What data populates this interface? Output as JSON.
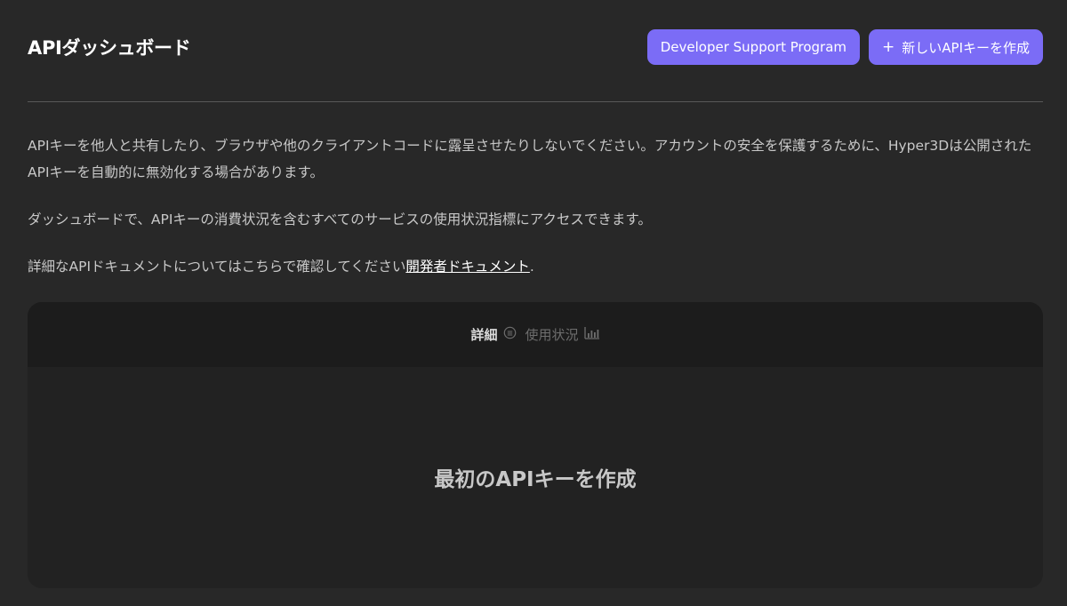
{
  "header": {
    "title": "APIダッシュボード",
    "developer_support_label": "Developer Support Program",
    "create_key_label": "新しいAPIキーを作成"
  },
  "intro": {
    "paragraph1": "APIキーを他人と共有したり、ブラウザや他のクライアントコードに露呈させたりしないでください。アカウントの安全を保護するために、Hyper3Dは公開されたAPIキーを自動的に無効化する場合があります。",
    "paragraph2": "ダッシュボードで、APIキーの消費状況を含むすべてのサービスの使用状況指標にアクセスできます。",
    "paragraph3_prefix": "詳細なAPIドキュメントについてはこちらで確認してください",
    "paragraph3_link": "開発者ドキュメント",
    "paragraph3_suffix": "."
  },
  "panel": {
    "tabs": [
      {
        "label": "詳細",
        "icon": "list-icon",
        "active": true
      },
      {
        "label": "使用状況",
        "icon": "bar-chart-icon",
        "active": false
      }
    ],
    "empty_state": "最初のAPIキーを作成"
  },
  "colors": {
    "background": "#282828",
    "accent": "#7b6cf6",
    "panel": "#222222",
    "panel_header": "#1c1c1c"
  }
}
